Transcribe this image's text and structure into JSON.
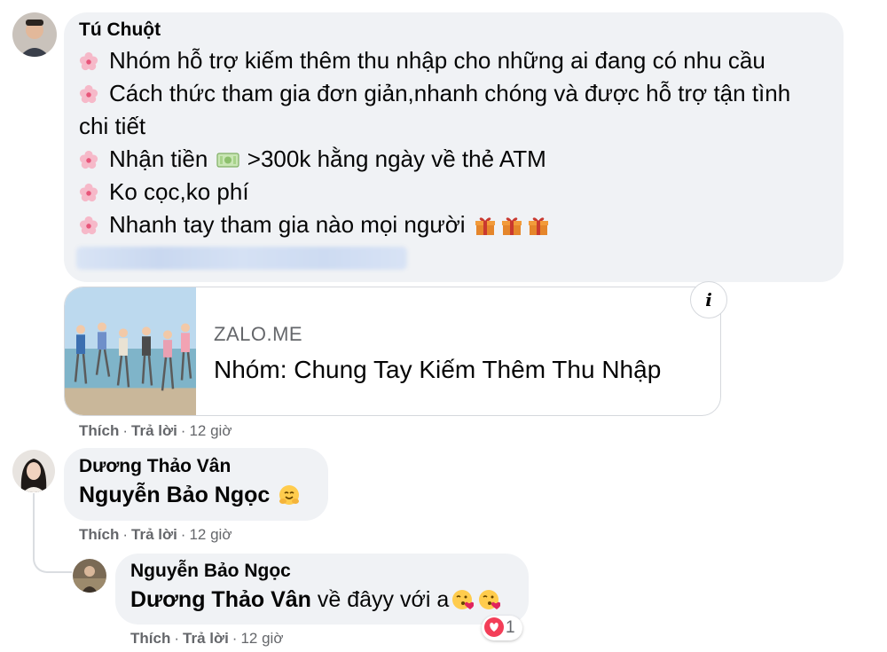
{
  "comment1": {
    "author": "Tú Chuột",
    "lines": [
      "Nhóm hỗ trợ kiếm thêm thu nhập cho những ai đang có nhu cầu",
      "Cách thức tham gia đơn giản,nhanh chóng và được hỗ trợ tận tình",
      "chi tiết",
      "Nhận tiền",
      ">300k hằng ngày về thẻ ATM",
      "Ko cọc,ko phí",
      "Nhanh tay tham gia nào mọi người"
    ],
    "link": {
      "domain": "ZALO.ME",
      "title": "Nhóm: Chung Tay Kiếm Thêm Thu Nhập",
      "info_icon": "i"
    },
    "actions": {
      "like": "Thích",
      "reply": "Trả lời",
      "time": "12 giờ"
    }
  },
  "comment2": {
    "author": "Dương Thảo Vân",
    "mention": "Nguyễn Bảo Ngọc",
    "actions": {
      "like": "Thích",
      "reply": "Trả lời",
      "time": "12 giờ"
    }
  },
  "comment3": {
    "author": "Nguyễn Bảo Ngọc",
    "mention": "Dương Thảo Vân",
    "text": "về đâyy với a",
    "reaction_count": "1",
    "actions": {
      "like": "Thích",
      "reply": "Trả lời",
      "time": "12 giờ"
    }
  },
  "icons": {
    "bullet": "cherry-blossom-icon",
    "money": "dollar-banknote-icon",
    "gift": "gift-icon",
    "hug": "hugging-face-icon",
    "kiss": "face-blowing-kiss-icon",
    "reaction": "heart-reaction-icon"
  },
  "colors": {
    "bubble": "#f0f2f5",
    "meta": "#65676b",
    "heart": "#f33e58"
  }
}
